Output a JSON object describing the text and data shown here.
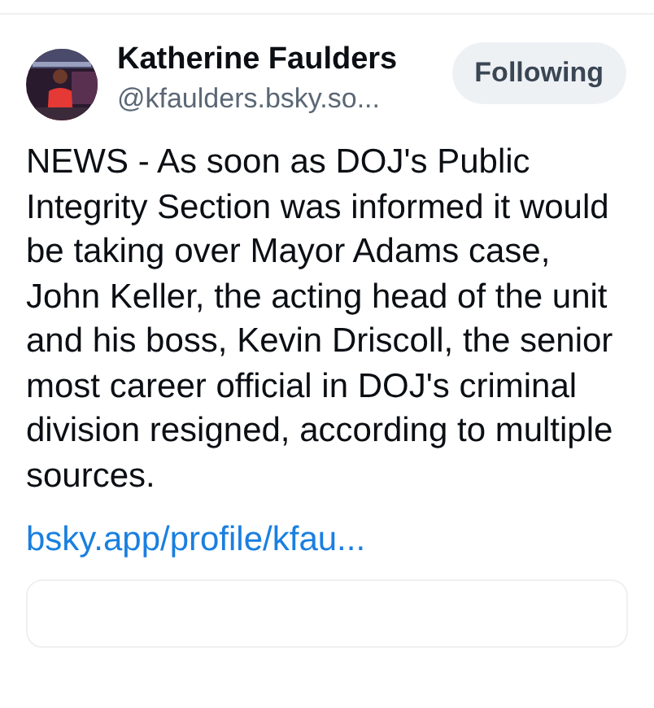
{
  "post": {
    "author": {
      "name": "Katherine Faulders",
      "handle": "@kfaulders.bsky.so..."
    },
    "follow_button": {
      "label": "Following",
      "following": true
    },
    "text": "NEWS - As soon as DOJ's Public Integrity Section was informed it would be taking over Mayor Adams case, John Keller, the acting head of the unit and his boss, Kevin Driscoll, the senior most career official in DOJ's criminal division resigned, according to multiple sources.",
    "link": "bsky.app/profile/kfau..."
  }
}
